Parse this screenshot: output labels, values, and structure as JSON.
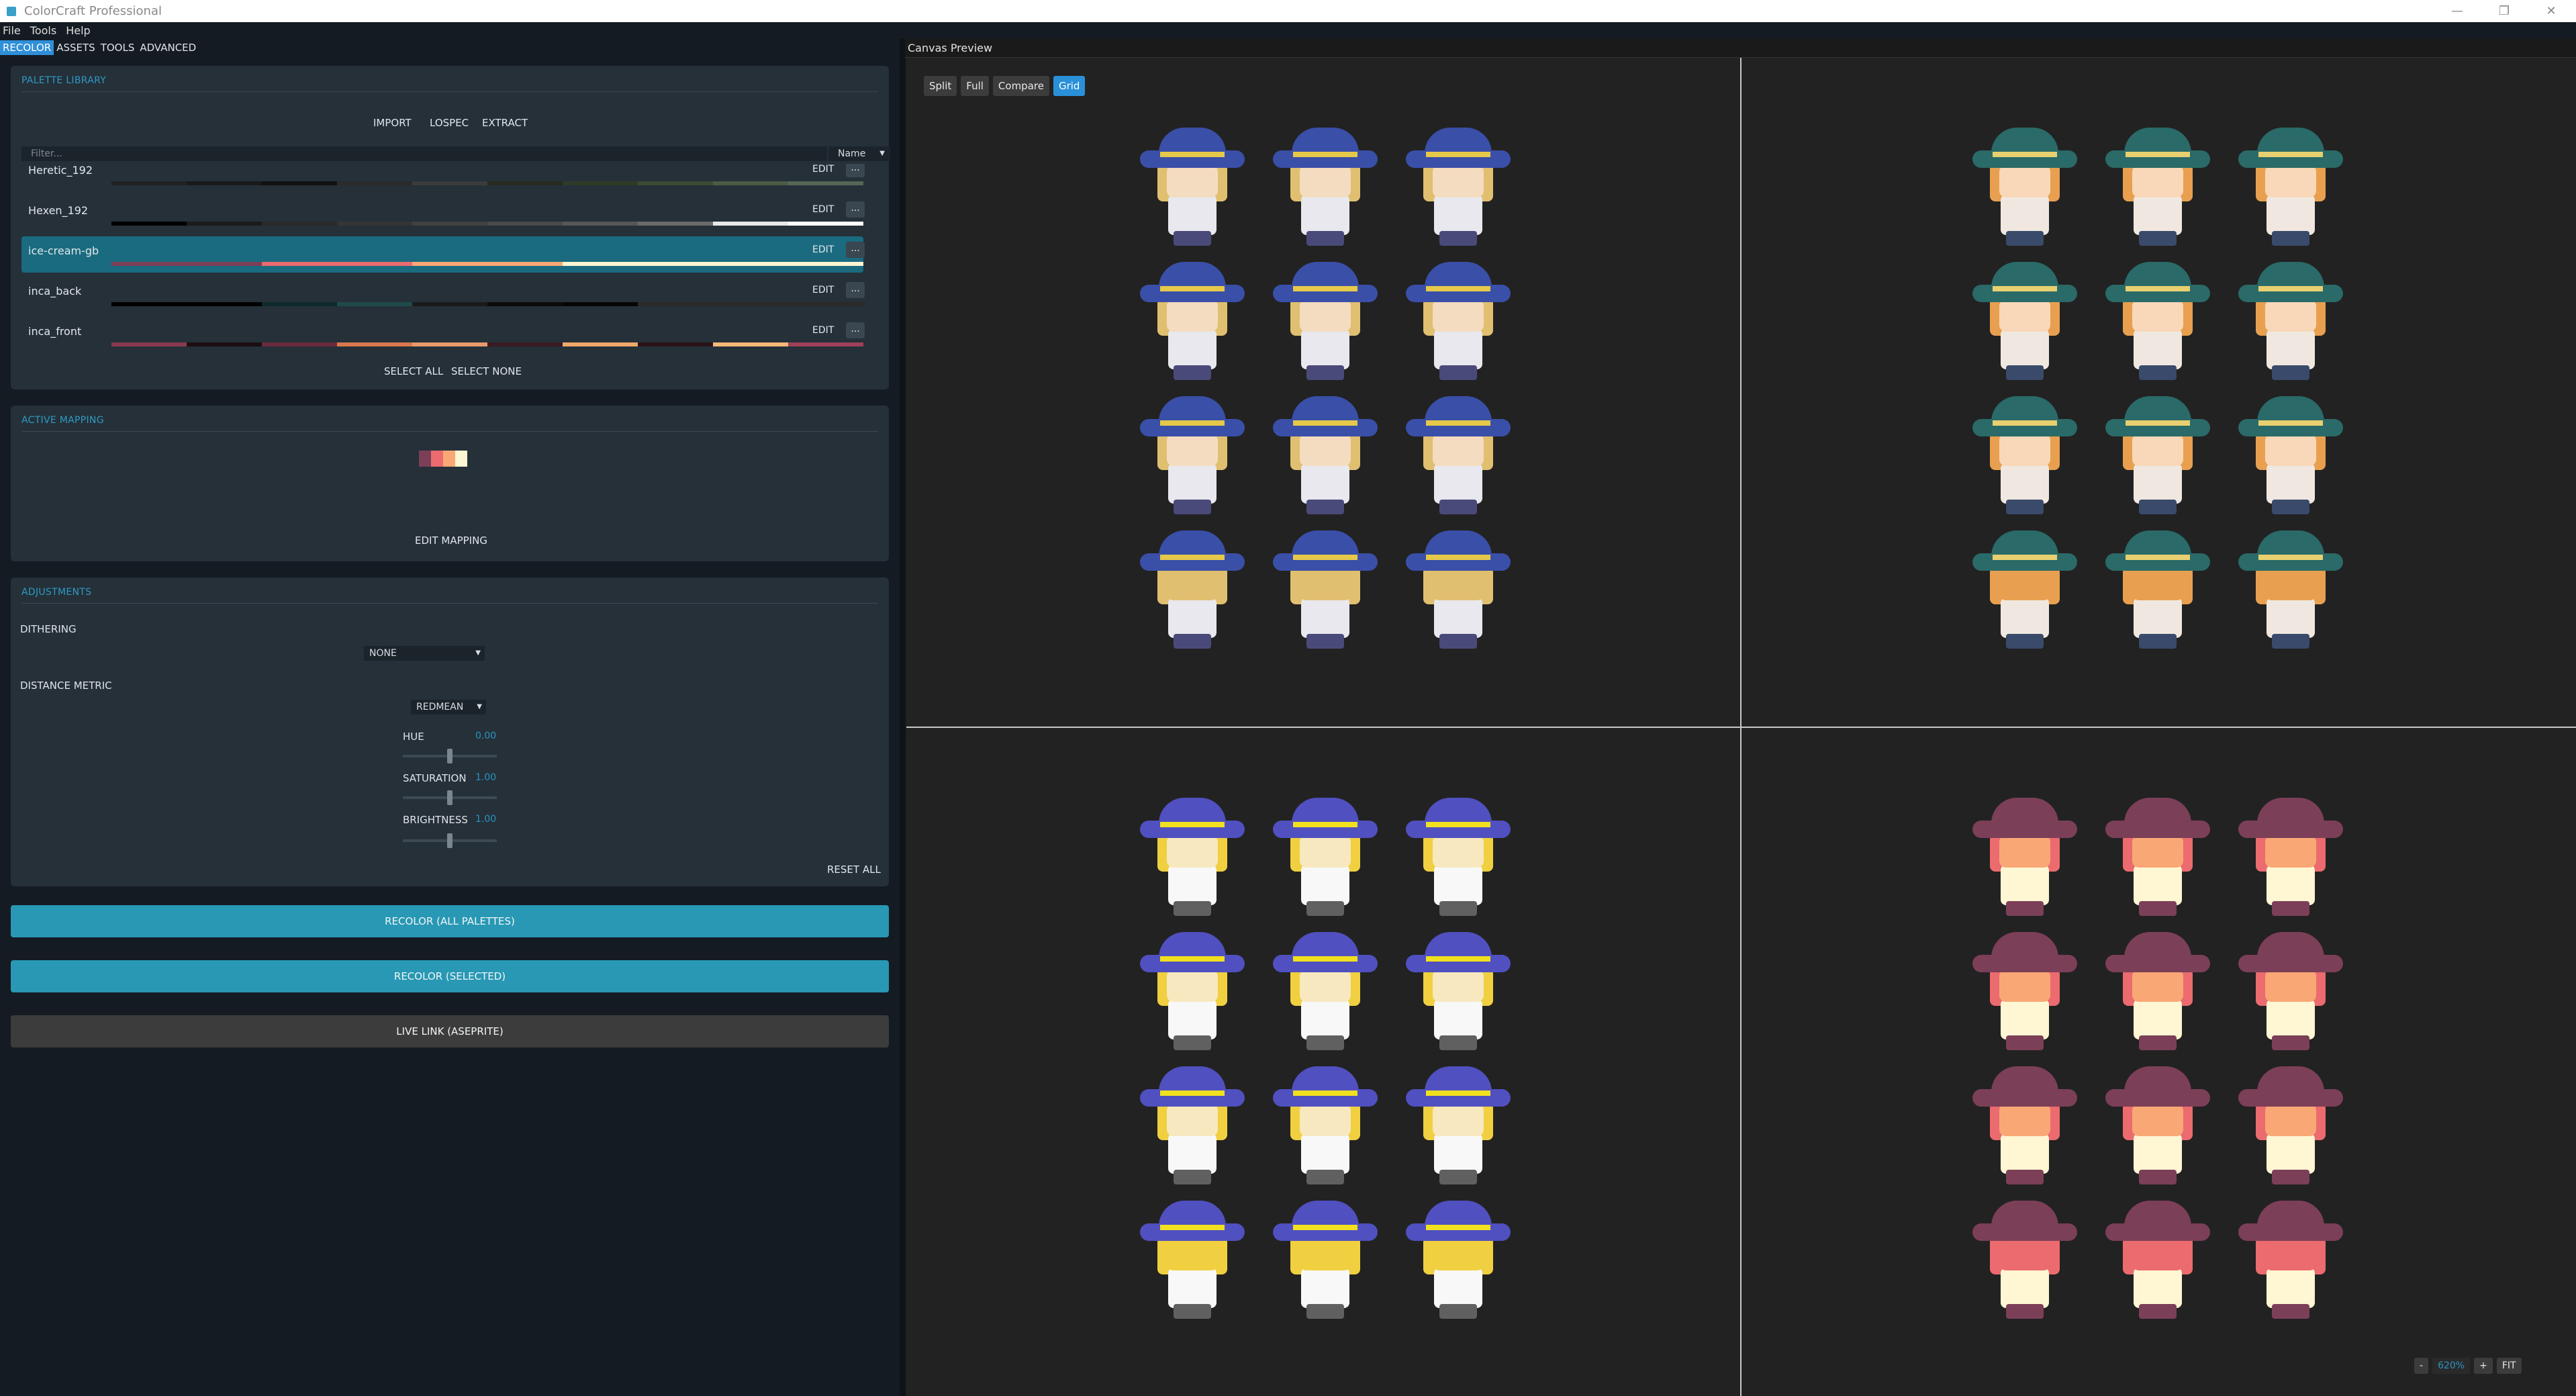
{
  "window": {
    "title": "ColorCraft Professional"
  },
  "menu": [
    "File",
    "Tools",
    "Help"
  ],
  "left_tabs": [
    {
      "label": "RECOLOR",
      "active": true
    },
    {
      "label": "ASSETS",
      "active": false
    },
    {
      "label": "TOOLS",
      "active": false
    },
    {
      "label": "ADVANCED",
      "active": false
    }
  ],
  "palette_library": {
    "title": "PALETTE LIBRARY",
    "import_label": "IMPORT",
    "lospec_label": "LOSPEC",
    "extract_label": "EXTRACT",
    "filter_placeholder": "Filter...",
    "sort_value": "Name",
    "edit_label": "EDIT",
    "more_label": "...",
    "palettes": [
      {
        "name": "Heretic_192",
        "selected": false,
        "colors": [
          "#222222",
          "#1a1a1a",
          "#111111",
          "#2b2b2b",
          "#3c3c3c",
          "#262a1f",
          "#2f3a28",
          "#3d4a34",
          "#4d5a44",
          "#556655"
        ]
      },
      {
        "name": "Hexen_192",
        "selected": false,
        "colors": [
          "#000000",
          "#1b1b1b",
          "#2a2a2a",
          "#353535",
          "#414141",
          "#4a4a4a",
          "#575757",
          "#6a6a6a",
          "#e8e8e8",
          "#ffffff"
        ]
      },
      {
        "name": "ice-cream-gb",
        "selected": true,
        "colors": [
          "#7c3f58",
          "#7c3f58",
          "#eb6b6f",
          "#eb6b6f",
          "#f9a875",
          "#f9a875",
          "#fff6d3",
          "#fff6d3",
          "#fff6d3",
          "#fff6d3"
        ]
      },
      {
        "name": "inca_back",
        "selected": false,
        "colors": [
          "#000000",
          "#000000",
          "#0e2a2a",
          "#1f4a4a",
          "#1a1a1a",
          "#0b0b0b",
          "#050505",
          "#2a2a2a",
          "#2a2a2a",
          "#2a2a2a"
        ]
      },
      {
        "name": "inca_front",
        "selected": false,
        "colors": [
          "#8a3a50",
          "#1a0f12",
          "#6b2a3d",
          "#d9784e",
          "#e89a6a",
          "#3a1a22",
          "#f0a86a",
          "#2a1218",
          "#f7b77a",
          "#a04058"
        ]
      }
    ],
    "select_all_label": "SELECT ALL",
    "select_none_label": "SELECT NONE"
  },
  "active_mapping": {
    "title": "ACTIVE MAPPING",
    "swatches": [
      "#7c3f58",
      "#eb6b6f",
      "#f9a875",
      "#fff6d3"
    ],
    "edit_label": "EDIT MAPPING"
  },
  "adjustments": {
    "title": "ADJUSTMENTS",
    "dithering_label": "DITHERING",
    "dithering_value": "NONE",
    "distance_label": "DISTANCE METRIC",
    "distance_value": "REDMEAN",
    "hue_label": "HUE",
    "hue_value": "0.00",
    "hue_level": 0.5,
    "saturation_label": "SATURATION",
    "saturation_value": "1.00",
    "saturation_level": 0.5,
    "brightness_label": "BRIGHTNESS",
    "brightness_value": "1.00",
    "brightness_level": 0.5,
    "reset_label": "RESET ALL"
  },
  "actions": {
    "recolor_all": "RECOLOR (ALL PALETTES)",
    "recolor_selected": "RECOLOR (SELECTED)",
    "live_link": "LIVE LINK (ASEPRITE)"
  },
  "canvas": {
    "title": "Canvas Preview",
    "view_buttons": [
      {
        "label": "Split",
        "active": false
      },
      {
        "label": "Full",
        "active": false
      },
      {
        "label": "Compare",
        "active": false
      },
      {
        "label": "Grid",
        "active": true
      }
    ],
    "quadrant_palettes": [
      {
        "hat": "#3a4fa8",
        "band": "#e6c84a",
        "hair": "#e0c070",
        "face": "#f4dcc0",
        "body": "#e8e8ee",
        "legs": "#4a4a7a"
      },
      {
        "hat": "#2a6a68",
        "band": "#e8d070",
        "hair": "#e8a050",
        "face": "#f8d8b8",
        "body": "#f0e8e0",
        "legs": "#3a4a6a"
      },
      {
        "hat": "#5050c0",
        "band": "#f0e020",
        "hair": "#f0d040",
        "face": "#f8e8c0",
        "body": "#f8f8f8",
        "legs": "#606060"
      },
      {
        "hat": "#7c3f58",
        "band": "#7c3f58",
        "hair": "#eb6b6f",
        "face": "#f9a875",
        "body": "#fff6d3",
        "legs": "#7c3f58"
      }
    ],
    "zoom": {
      "minus": "-",
      "value": "620%",
      "plus": "+",
      "fit": "FIT"
    }
  }
}
